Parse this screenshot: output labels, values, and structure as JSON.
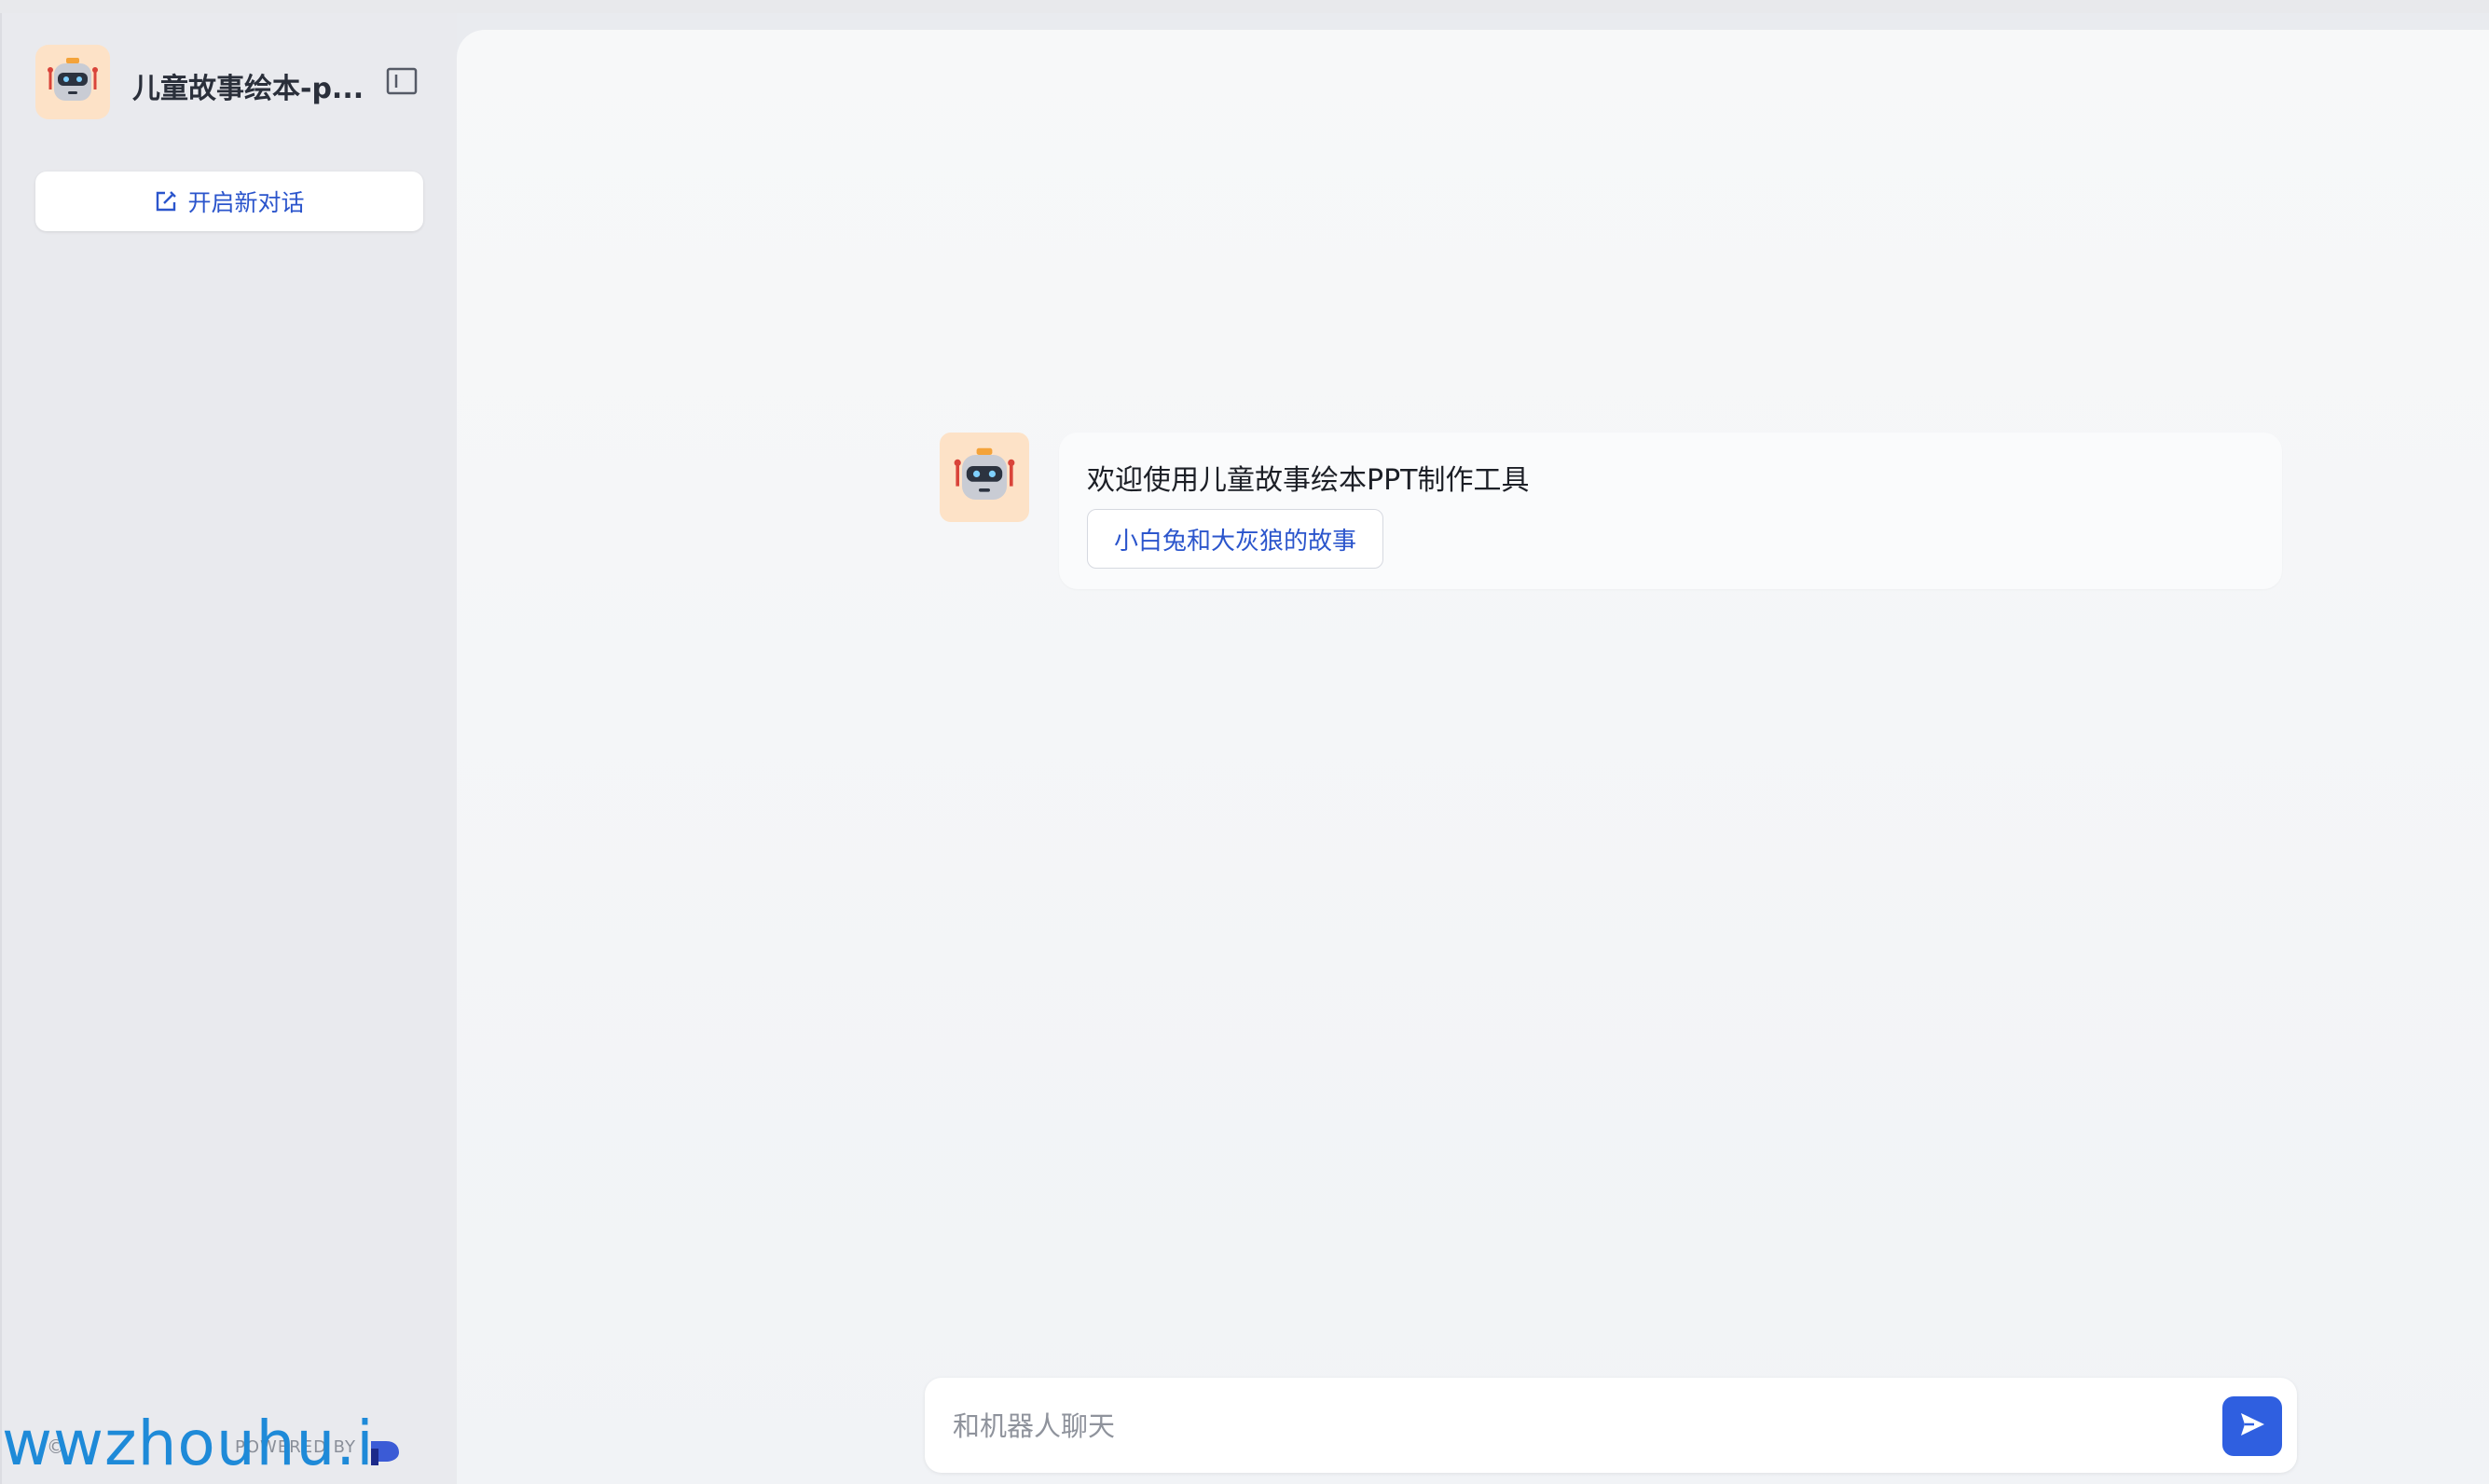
{
  "app": {
    "title": "儿童故事绘本-p...",
    "new_chat_label": "开启新对话"
  },
  "welcome": {
    "message": "欢迎使用儿童故事绘本PPT制作工具",
    "suggestions": [
      "小白兔和大灰狼的故事"
    ]
  },
  "input": {
    "placeholder": "和机器人聊天"
  },
  "footer": {
    "watermark": "wwzhouhu.i",
    "copyright": "©",
    "powered_by": "POWERED BY"
  },
  "icons": {
    "app_avatar": "robot-icon",
    "collapse": "sidebar-collapse-icon",
    "new_chat": "edit-icon",
    "send": "send-icon",
    "brand": "brand-logo"
  },
  "colors": {
    "accent": "#2b55cc",
    "send_button": "#2f5fe0",
    "avatar_bg": "#fde2c7",
    "watermark": "#1e8ad8"
  }
}
